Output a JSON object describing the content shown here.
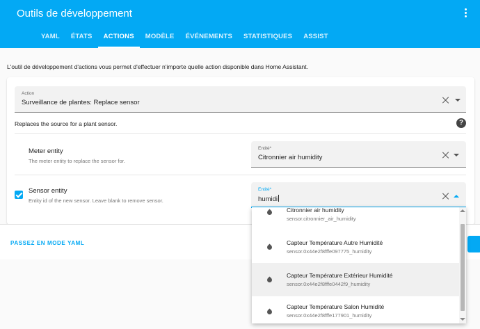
{
  "app": {
    "title": "Outils de développement",
    "tabs": [
      {
        "label": "YAML",
        "active": false
      },
      {
        "label": "ÉTATS",
        "active": false
      },
      {
        "label": "ACTIONS",
        "active": true
      },
      {
        "label": "MODÈLE",
        "active": false
      },
      {
        "label": "ÉVÉNEMENTS",
        "active": false
      },
      {
        "label": "STATISTIQUES",
        "active": false
      },
      {
        "label": "ASSIST",
        "active": false
      }
    ],
    "accent_color": "#03a9f4"
  },
  "intro_text": "L'outil de développement d'actions vous permet d'effectuer n'importe quelle action disponible dans Home Assistant.",
  "action": {
    "label": "Action",
    "value": "Surveillance de plantes: Replace sensor",
    "description": "Replaces the source for a plant sensor."
  },
  "meter": {
    "title": "Meter entity",
    "subtitle": "The meter entity to replace the sensor for.",
    "field_label": "Entité*",
    "value": "Citronnier air humidity"
  },
  "sensor": {
    "title": "Sensor entity",
    "subtitle": "Entity id of the new sensor. Leave blank to remove sensor.",
    "field_label": "Entité*",
    "value": "humidi",
    "checked": true
  },
  "yaml_mode_label": "PASSEZ EN MODE YAML",
  "dropdown": {
    "items": [
      {
        "name": "Citronnier air humidity",
        "entity_id": "sensor.citronnier_air_humidity",
        "icon": "water-percent-icon"
      },
      {
        "name": "Capteur Température Autre Humidité",
        "entity_id": "sensor.0x44e2f8fffe097775_humidity",
        "icon": "water-percent-icon"
      },
      {
        "name": "Capteur Température Extérieur Humidité",
        "entity_id": "sensor.0x44e2f8fffe0442f9_humidity",
        "icon": "water-percent-icon"
      },
      {
        "name": "Capteur Température Salon Humidité",
        "entity_id": "sensor.0x44e2f8fffe177901_humidity",
        "icon": "water-percent-icon"
      }
    ]
  }
}
